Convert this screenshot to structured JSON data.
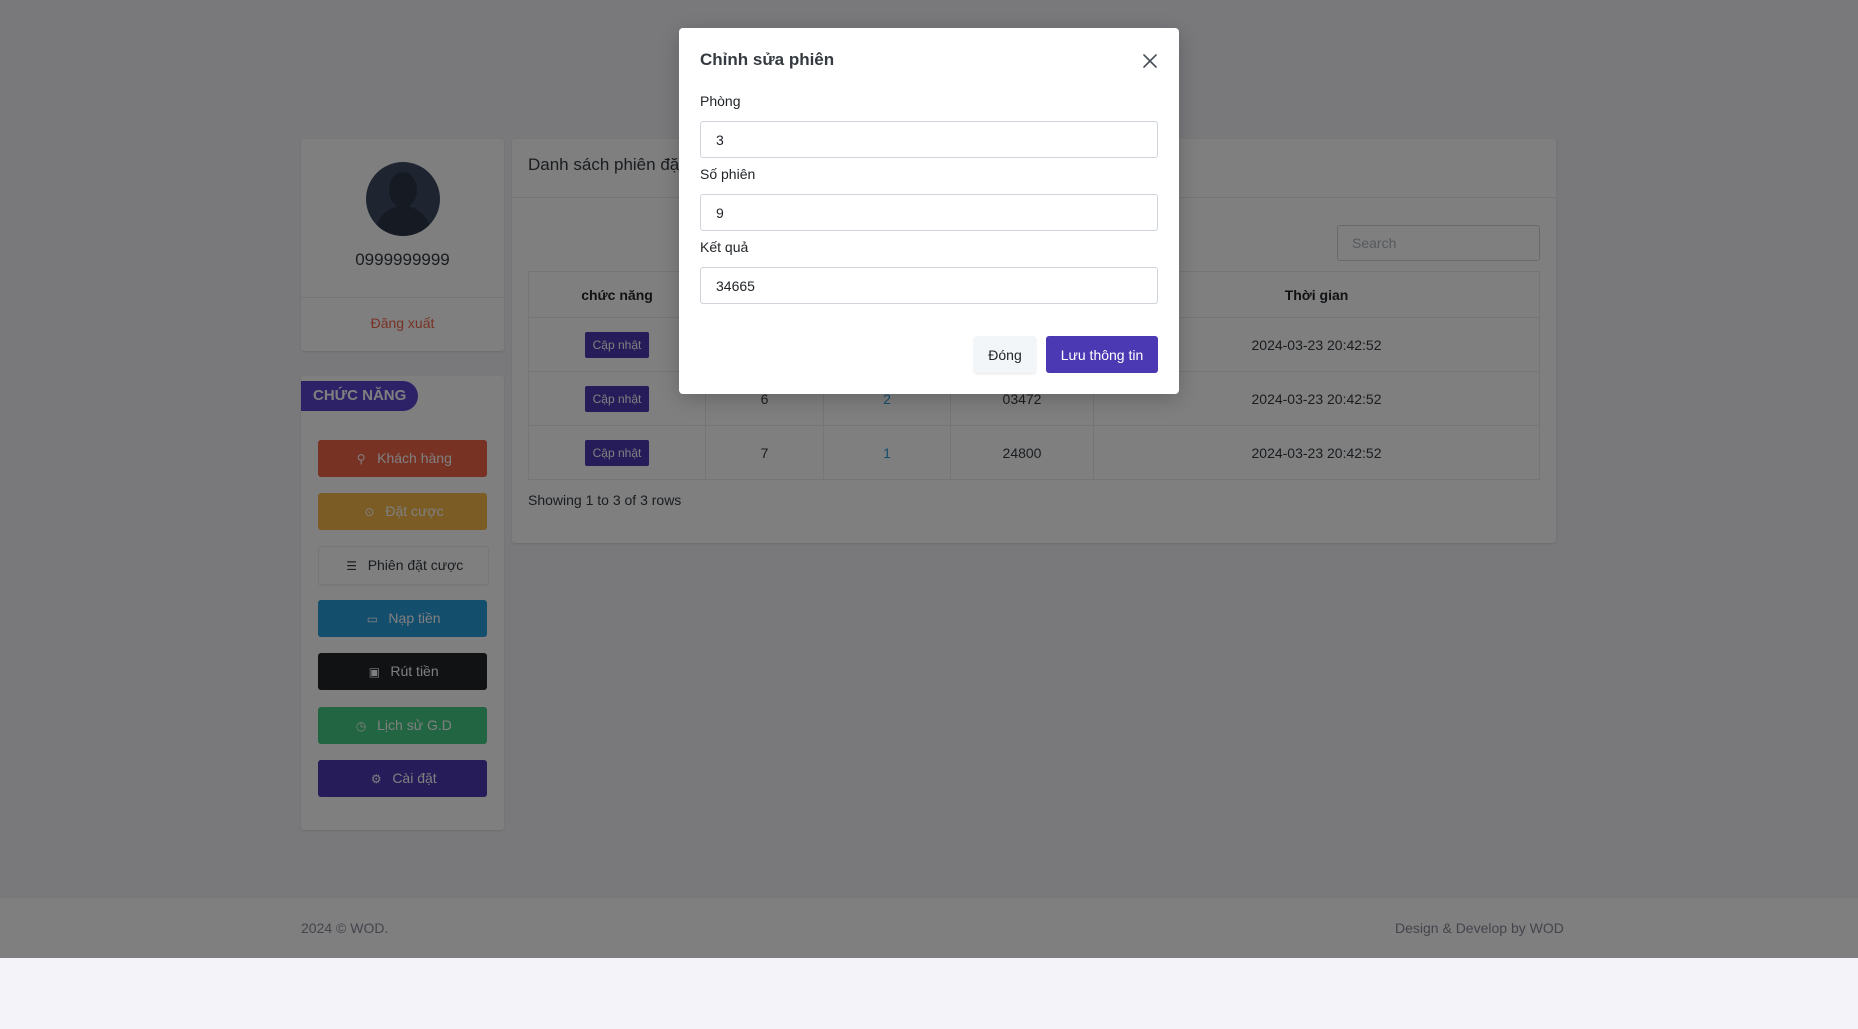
{
  "profile": {
    "phone": "0999999999",
    "logout": "Đăng xuất"
  },
  "menu": {
    "title": "CHỨC NĂNG",
    "items": [
      {
        "label": "Khách hàng",
        "icon": "user-icon"
      },
      {
        "label": "Đặt cược",
        "icon": "play-circle-icon"
      },
      {
        "label": "Phiên đặt cược",
        "icon": "list-icon"
      },
      {
        "label": "Nạp tiền",
        "icon": "card-icon"
      },
      {
        "label": "Rút tiền",
        "icon": "wallet-icon"
      },
      {
        "label": "Lịch sử G.D",
        "icon": "history-icon"
      },
      {
        "label": "Cài đặt",
        "icon": "gear-icon"
      }
    ],
    "colors": {
      "customers": "#f06548",
      "bet": "#f7b84b",
      "deposit": "#299cdb",
      "withdraw": "#212529",
      "history": "#45cb85",
      "settings": "#4b38b3"
    }
  },
  "main": {
    "title": "Danh sách phiên đặ",
    "search_placeholder": "Search",
    "columns": [
      "chức năng",
      "",
      "",
      "",
      "Thời gian"
    ],
    "rows": [
      {
        "action": "Cập nhật",
        "c2": "",
        "c3": "",
        "c4": "",
        "time": "2024-03-23 20:42:52"
      },
      {
        "action": "Cập nhật",
        "c2": "6",
        "c3": "2",
        "c4": "03472",
        "time": "2024-03-23 20:42:52"
      },
      {
        "action": "Cập nhật",
        "c2": "7",
        "c3": "1",
        "c4": "24800",
        "time": "2024-03-23 20:42:52"
      }
    ],
    "showing": "Showing 1 to 3 of 3 rows"
  },
  "footer": {
    "left": "2024 © WOD.",
    "right": "Design & Develop by WOD"
  },
  "modal": {
    "title": "Chỉnh sửa phiên",
    "fields": [
      {
        "label": "Phòng",
        "value": "3"
      },
      {
        "label": "Số phiên",
        "value": "9"
      },
      {
        "label": "Kết quả",
        "value": "34665"
      }
    ],
    "close_label": "Đóng",
    "save_label": "Lưu thông tin",
    "accent": "#4b38b3"
  }
}
